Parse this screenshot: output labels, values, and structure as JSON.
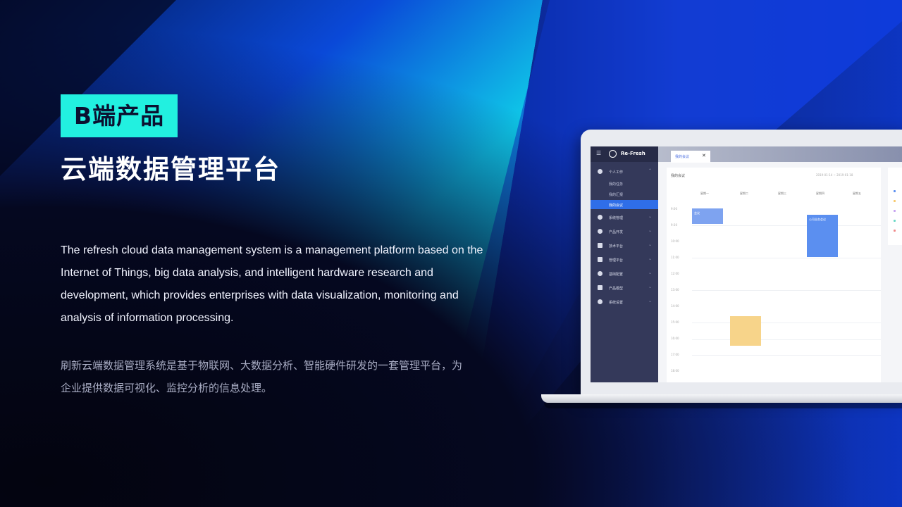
{
  "tag": "B端产品",
  "title": "云端数据管理平台",
  "description_en": "The refresh cloud data management system is a management platform based on the Internet of Things, big data analysis, and intelligent hardware research and development, which provides enterprises with data visualization, monitoring and analysis of information processing.",
  "description_cn": "刷新云端数据管理系统是基于物联网、大数据分析、智能硬件研发的一套管理平台，为企业提供数据可视化、监控分析的信息处理。",
  "colors": {
    "accent": "#22f0e0",
    "primary_blue": "#2f6ee8",
    "sidebar": "#34395a"
  },
  "app": {
    "brand": "Re-Fresh",
    "tab_label": "我的会议",
    "tab_close": "✕",
    "sidebar": {
      "menu": [
        {
          "label": "个人工作",
          "icon": "user-icon",
          "expanded": true
        },
        {
          "label": "系统管理",
          "icon": "settings-icon"
        },
        {
          "label": "产品开发",
          "icon": "product-icon"
        },
        {
          "label": "技术平台",
          "icon": "folder-icon"
        },
        {
          "label": "管理平台",
          "icon": "monitor-icon"
        },
        {
          "label": "基础配置",
          "icon": "config-icon"
        },
        {
          "label": "产品模型",
          "icon": "model-icon"
        },
        {
          "label": "系统设置",
          "icon": "gear-icon"
        }
      ],
      "submenu": [
        {
          "label": "我的任务"
        },
        {
          "label": "我的汇报"
        },
        {
          "label": "我的会议",
          "active": true
        }
      ]
    },
    "calendar": {
      "title": "我的会议",
      "date_range": "2019-01-14 ~ 2019-01-18",
      "days": [
        "星期一",
        "星期二",
        "星期三",
        "星期四",
        "星期五"
      ],
      "times": [
        "9:00",
        "9:30",
        "10:00",
        "11:00",
        "12:00",
        "13:00",
        "14:00",
        "15:00",
        "16:00",
        "17:00",
        "18:00"
      ],
      "events": [
        {
          "label": "会议",
          "day": "星期一",
          "color": "#7ea3f0"
        },
        {
          "label": "公司业务会议",
          "day": "星期四",
          "color": "#5b8ff0"
        },
        {
          "label": "",
          "day": "星期二",
          "color": "#f7d48a"
        }
      ]
    }
  }
}
